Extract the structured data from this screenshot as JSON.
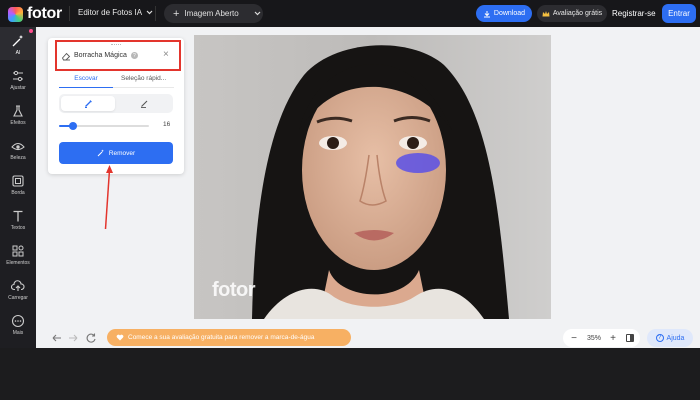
{
  "app": {
    "logo_text": "fotor"
  },
  "header": {
    "editor_menu_label": "Editor de Fotos IA",
    "open_image_label": "Imagem Aberto",
    "download_label": "Download",
    "trial_label": "Avaliação grátis",
    "register_label": "Registrar-se",
    "enter_label": "Entrar"
  },
  "sidebar": {
    "items": [
      {
        "label": "AI"
      },
      {
        "label": "Ajustar"
      },
      {
        "label": "Efeitos"
      },
      {
        "label": "Beleza"
      },
      {
        "label": "Borda"
      },
      {
        "label": "Textos"
      },
      {
        "label": "Elementos"
      },
      {
        "label": "Carregar"
      },
      {
        "label": "Mais"
      }
    ]
  },
  "panel": {
    "title": "Borracha Mágica",
    "tabs": [
      {
        "label": "Escovar"
      },
      {
        "label": "Seleção rápid..."
      }
    ],
    "brush_size": "16",
    "brush_size_fraction": 0.15,
    "remove_label": "Remover"
  },
  "canvas": {
    "watermark": "fotor"
  },
  "bottom": {
    "promo_text": "Comece a sua avaliação gratuita para remover a marca-de-água",
    "zoom_level": "35%",
    "help_label": "Ajuda"
  },
  "colors": {
    "accent": "#2d6ef2",
    "highlight": "#e3352d",
    "promo": "#f7b063",
    "mask": "#5a50e6"
  }
}
